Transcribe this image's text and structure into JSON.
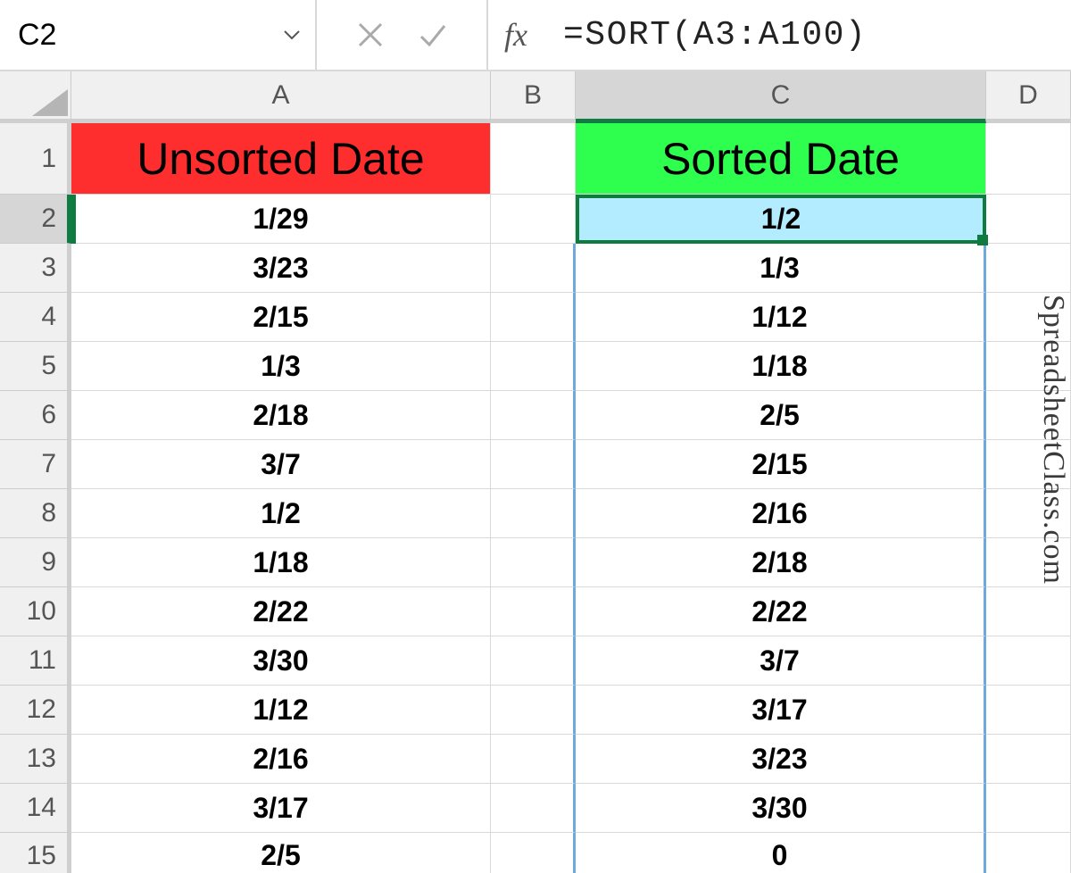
{
  "nameBox": {
    "value": "C2"
  },
  "formula": {
    "fx_label": "fx",
    "value": "=SORT(A3:A100)"
  },
  "columns": [
    "A",
    "B",
    "C",
    "D"
  ],
  "activeColumn": "C",
  "activeRow": 2,
  "rows": [
    1,
    2,
    3,
    4,
    5,
    6,
    7,
    8,
    9,
    10,
    11,
    12,
    13,
    14,
    15
  ],
  "sheet": {
    "A": {
      "1": "Unsorted Date",
      "2": "1/29",
      "3": "3/23",
      "4": "2/15",
      "5": "1/3",
      "6": "2/18",
      "7": "3/7",
      "8": "1/2",
      "9": "1/18",
      "10": "2/22",
      "11": "3/30",
      "12": "1/12",
      "13": "2/16",
      "14": "3/17",
      "15": "2/5"
    },
    "B": {},
    "C": {
      "1": "Sorted Date",
      "2": "1/2",
      "3": "1/3",
      "4": "1/12",
      "5": "1/18",
      "6": "2/5",
      "7": "2/15",
      "8": "2/16",
      "9": "2/18",
      "10": "2/22",
      "11": "3/7",
      "12": "3/17",
      "13": "3/23",
      "14": "3/30",
      "15": "0"
    },
    "D": {}
  },
  "watermark": "SpreadsheetClass.com"
}
